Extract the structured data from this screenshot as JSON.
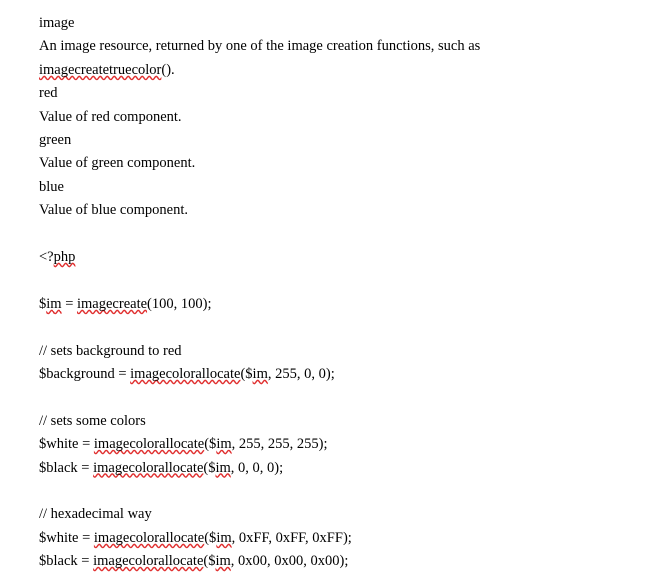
{
  "document": {
    "lines": [
      {
        "id": "l1",
        "text": "image",
        "justify": false,
        "spell": []
      },
      {
        "id": "l2",
        "text": "An image resource, returned by one of the image creation functions, such as",
        "justify": true,
        "spell": []
      },
      {
        "id": "l3",
        "text": "imagecreatetruecolor().",
        "justify": false,
        "spell": [
          "imagecreatetruecolor"
        ]
      },
      {
        "id": "l4",
        "text": "red",
        "justify": false,
        "spell": []
      },
      {
        "id": "l5",
        "text": "Value of red component.",
        "justify": false,
        "spell": []
      },
      {
        "id": "l6",
        "text": "green",
        "justify": false,
        "spell": []
      },
      {
        "id": "l7",
        "text": "Value of green component.",
        "justify": false,
        "spell": []
      },
      {
        "id": "l8",
        "text": "blue",
        "justify": false,
        "spell": []
      },
      {
        "id": "l9",
        "text": "Value of blue component.",
        "justify": false,
        "spell": []
      },
      {
        "id": "l10",
        "text": "",
        "justify": false,
        "spell": []
      },
      {
        "id": "l11",
        "text": "<?php",
        "justify": false,
        "spell": [
          "php"
        ]
      },
      {
        "id": "l12",
        "text": "",
        "justify": false,
        "spell": []
      },
      {
        "id": "l13",
        "text": "$im = imagecreate(100, 100);",
        "justify": false,
        "spell": [
          "im",
          "imagecreate"
        ]
      },
      {
        "id": "l14",
        "text": "",
        "justify": false,
        "spell": []
      },
      {
        "id": "l15",
        "text": "// sets background to red",
        "justify": false,
        "spell": []
      },
      {
        "id": "l16",
        "text": "$background = imagecolorallocate($im, 255, 0, 0);",
        "justify": false,
        "spell": [
          "imagecolorallocate",
          "im"
        ]
      },
      {
        "id": "l17",
        "text": "",
        "justify": false,
        "spell": []
      },
      {
        "id": "l18",
        "text": "// sets some colors",
        "justify": false,
        "spell": []
      },
      {
        "id": "l19",
        "text": "$white = imagecolorallocate($im, 255, 255, 255);",
        "justify": false,
        "spell": [
          "imagecolorallocate",
          "im"
        ]
      },
      {
        "id": "l20",
        "text": "$black = imagecolorallocate($im, 0, 0, 0);",
        "justify": false,
        "spell": [
          "imagecolorallocate",
          "im"
        ]
      },
      {
        "id": "l21",
        "text": "",
        "justify": false,
        "spell": []
      },
      {
        "id": "l22",
        "text": "// hexadecimal way",
        "justify": false,
        "spell": []
      },
      {
        "id": "l23",
        "text": "$white = imagecolorallocate($im, 0xFF, 0xFF, 0xFF);",
        "justify": false,
        "spell": [
          "imagecolorallocate",
          "im"
        ]
      },
      {
        "id": "l24",
        "text": "$black = imagecolorallocate($im, 0x00, 0x00, 0x00);",
        "justify": false,
        "spell": [
          "imagecolorallocate",
          "im"
        ]
      }
    ],
    "spell_underline_color": "#e03030",
    "text_color": "#000000",
    "background_color": "#ffffff"
  }
}
